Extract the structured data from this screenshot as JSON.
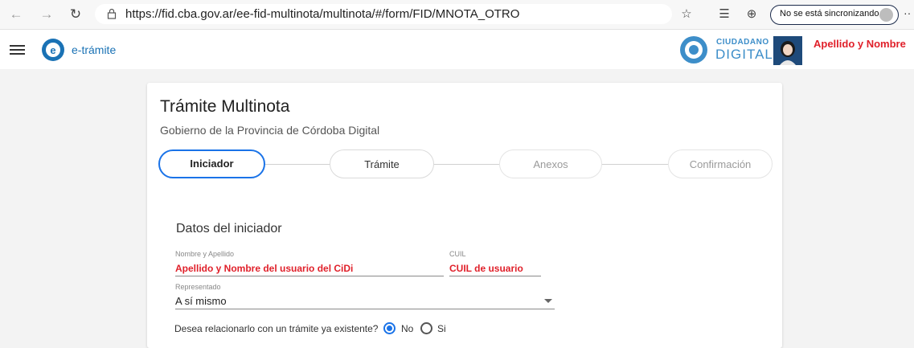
{
  "browser": {
    "url": "https://fid.cba.gov.ar/ee-fid-multinota/multinota/#/form/FID/MNOTA_OTRO",
    "sync_label": "No se está sincronizando"
  },
  "header": {
    "brand": "e-trámite",
    "cidi_small": "CIUDADANO",
    "cidi_big": "DIGITAL",
    "user_name": "Apellido y Nombre"
  },
  "form": {
    "title": "Trámite Multinota",
    "subtitle": "Gobierno de la Provincia de Córdoba Digital",
    "steps": [
      {
        "label": "Iniciador",
        "state": "active"
      },
      {
        "label": "Trámite",
        "state": "done"
      },
      {
        "label": "Anexos",
        "state": "pending"
      },
      {
        "label": "Confirmación",
        "state": "pending"
      }
    ],
    "section_title": "Datos del iniciador",
    "fields": {
      "nombre": {
        "label": "Nombre y Apellido",
        "value": "Apellido y Nombre del usuario del CiDi"
      },
      "cuil": {
        "label": "CUIL",
        "value": "CUIL de usuario"
      },
      "representado": {
        "label": "Representado",
        "value": "A sí mismo"
      }
    },
    "question": {
      "text": "Desea relacionarlo con un trámite ya existente?",
      "options": [
        "No",
        "Si"
      ],
      "selected": "No"
    }
  },
  "colors": {
    "accent": "#1a73e8",
    "highlight": "#e0202a",
    "brand": "#1a72b5"
  }
}
